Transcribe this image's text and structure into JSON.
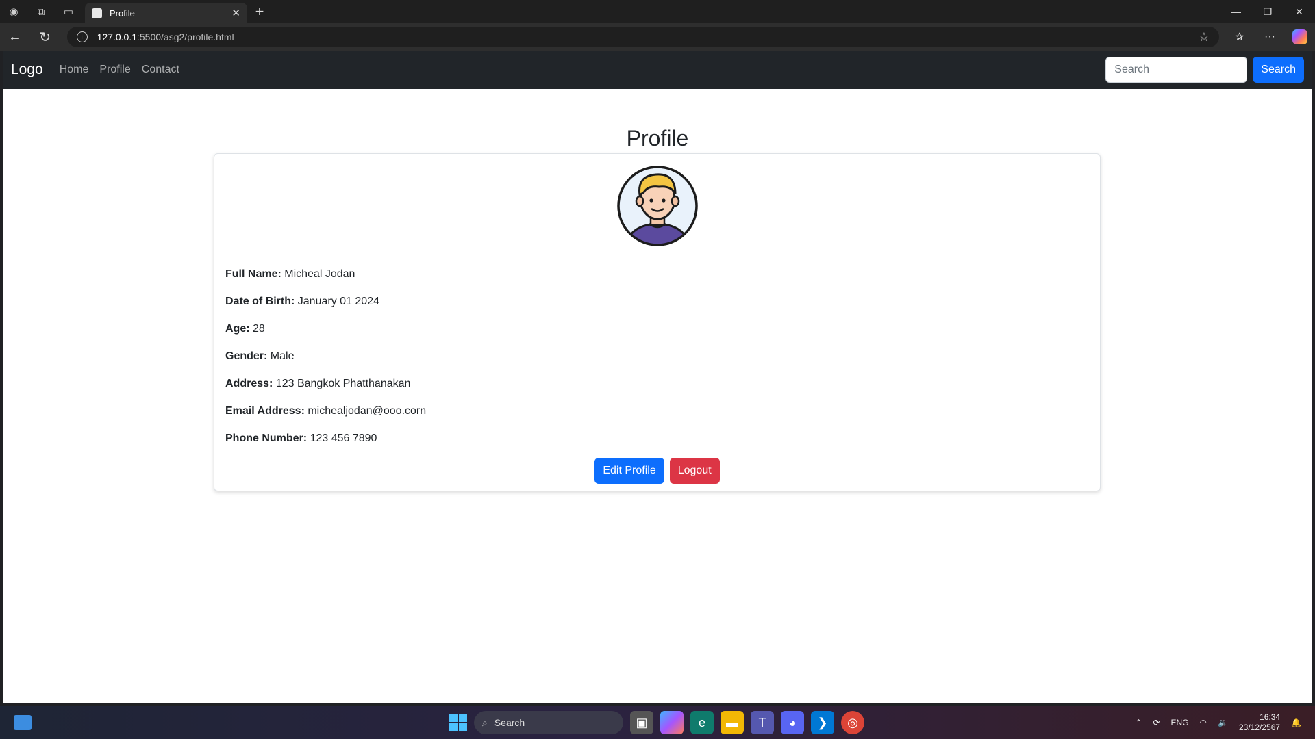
{
  "browser": {
    "tab_title": "Profile",
    "url_host": "127.0.0.1",
    "url_rest": ":5500/asg2/profile.html"
  },
  "navbar": {
    "brand": "Logo",
    "links": [
      "Home",
      "Profile",
      "Contact"
    ],
    "search_placeholder": "Search",
    "search_button": "Search"
  },
  "page": {
    "title": "Profile",
    "fields": [
      {
        "label": "Full Name:",
        "value": "Micheal Jodan"
      },
      {
        "label": "Date of Birth:",
        "value": "January 01 2024"
      },
      {
        "label": "Age:",
        "value": "28"
      },
      {
        "label": "Gender:",
        "value": "Male"
      },
      {
        "label": "Address:",
        "value": "123 Bangkok Phatthanakan"
      },
      {
        "label": "Email Address:",
        "value": "michealjodan@ooo.corn"
      },
      {
        "label": "Phone Number:",
        "value": "123 456 7890"
      }
    ],
    "edit_button": "Edit Profile",
    "logout_button": "Logout"
  },
  "taskbar": {
    "search_label": "Search",
    "language": "ENG",
    "time": "16:34",
    "date": "23/12/2567"
  },
  "colors": {
    "primary": "#0d6efd",
    "danger": "#dc3545",
    "navbar_bg": "#212529"
  }
}
